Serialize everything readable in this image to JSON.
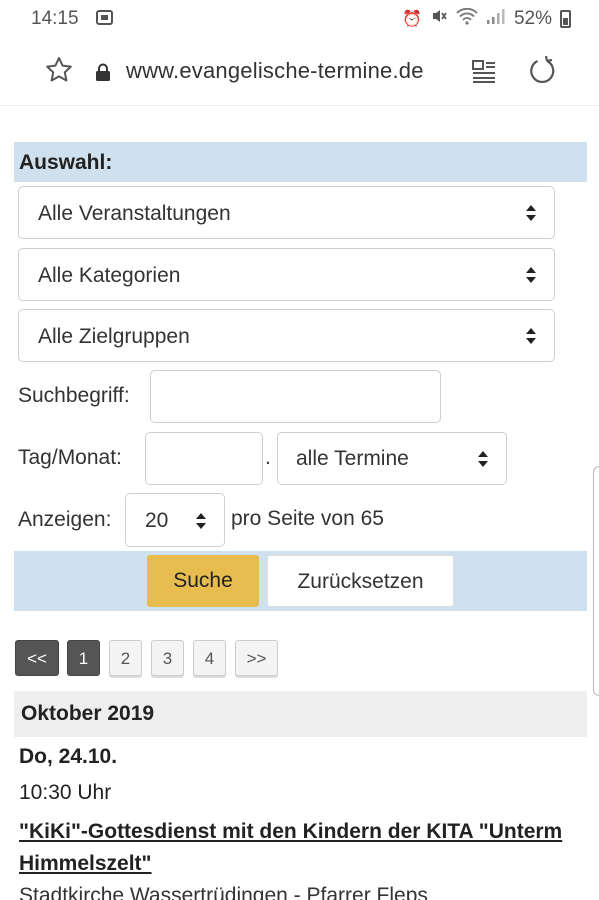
{
  "status_bar": {
    "time": "14:15",
    "battery": "52%"
  },
  "browser": {
    "url": "www.evangelische-termine.de"
  },
  "form": {
    "section_title": "Auswahl:",
    "event_select": "Alle Veranstaltungen",
    "category_select": "Alle Kategorien",
    "audience_select": "Alle Zielgruppen",
    "search_label": "Suchbegriff:",
    "search_value": "",
    "day_month_label": "Tag/Monat:",
    "day_month_value": "",
    "date_separator": ".",
    "range_select": "alle Termine",
    "show_label": "Anzeigen:",
    "per_page_select": "20",
    "per_page_suffix": "pro Seite von 65",
    "search_button": "Suche",
    "reset_button": "Zurücksetzen"
  },
  "pagination": {
    "first": "<<",
    "pages": [
      "1",
      "2",
      "3",
      "4"
    ],
    "current": "1",
    "last": ">>"
  },
  "events": {
    "month": "Oktober 2019",
    "items": [
      {
        "date": "Do, 24.10.",
        "time": "10:30 Uhr",
        "title": "\"KiKi\"-Gottesdienst mit den Kindern der KITA \"Unterm Himmelszelt\"",
        "place": "Stadtkirche Wassertrüdingen - Pfarrer Fleps"
      }
    ]
  },
  "colors": {
    "section_bg": "#cfe0ee",
    "search_button": "#e6bd4e",
    "pager_active": "#555555",
    "month_bg": "#eeeeee"
  },
  "icons": [
    "message-icon",
    "alarm-icon",
    "mute-icon",
    "wifi-icon",
    "signal-icon",
    "battery-icon",
    "star-icon",
    "lock-icon",
    "reader-mode-icon",
    "reload-icon",
    "select-arrows-icon"
  ]
}
